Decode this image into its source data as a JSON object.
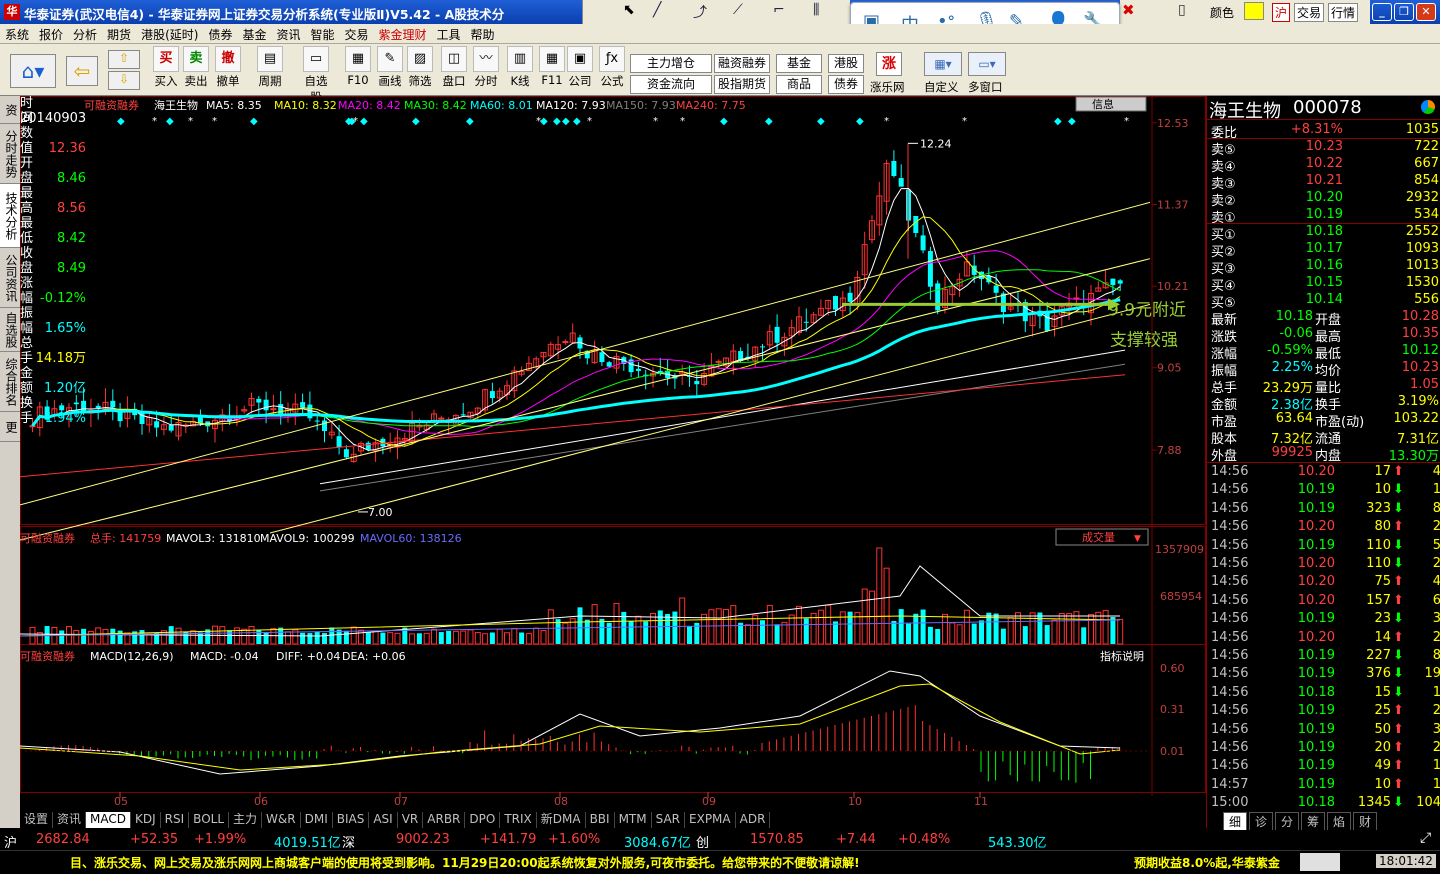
{
  "title": "华泰证券(武汉电信4)  -  华泰证券网上证券交易分析系统(专业版Ⅱ)V5.42  -  A股技术分",
  "titlebar_right": {
    "color_label": "颜色",
    "b1": "沪",
    "b2": "交易",
    "b3": "行情"
  },
  "menu": [
    "系统",
    "报价",
    "分析",
    "期货",
    "港股(延时)",
    "债券",
    "基金",
    "资讯",
    "智能",
    "交易",
    "紫金理财",
    "工具",
    "帮助"
  ],
  "toolbar": {
    "items": [
      "买入",
      "卖出",
      "撤单",
      "周期",
      "自选股",
      "F10",
      "画线",
      "筛选",
      "盘口",
      "分时",
      "K线",
      "F11",
      "公司",
      "公式"
    ],
    "icons": [
      "买",
      "卖",
      "撤"
    ],
    "w1": "主力增仓",
    "w2": "资金流向",
    "w3": "融资融券",
    "w4": "股指期货",
    "w5": "基金",
    "w6": "商品",
    "w7": "港股",
    "w8": "债券",
    "zhang": "涨",
    "zhangle": "涨乐网",
    "custom": "自定义",
    "multi": "多窗口"
  },
  "sidebar": [
    "资讯",
    "分时走势",
    "技术分析",
    "公司资讯",
    "自选股",
    "综合排名",
    "更多..."
  ],
  "info": {
    "rows": [
      {
        "label": "时间",
        "value": "20140903",
        "color": "#ffffff"
      },
      {
        "label": "数值",
        "value": "12.36",
        "color": "#ff4040"
      },
      {
        "label": "开盘",
        "value": "8.46",
        "color": "#00ff00"
      },
      {
        "label": "最高",
        "value": "8.56",
        "color": "#ff4040"
      },
      {
        "label": "最低",
        "value": "8.42",
        "color": "#00ff00"
      },
      {
        "label": "收盘",
        "value": "8.49",
        "color": "#00ff00"
      },
      {
        "label": "涨幅",
        "value": "-0.12%",
        "color": "#00ff00"
      },
      {
        "label": "振幅",
        "value": "1.65%",
        "color": "#00ffff"
      },
      {
        "label": "总手",
        "value": "14.18万",
        "color": "#ffff00"
      },
      {
        "label": "金额",
        "value": "1.20亿",
        "color": "#00ffff"
      },
      {
        "label": "换手",
        "value": "1.94%",
        "color": "#00ffff"
      }
    ]
  },
  "kline": {
    "source": "可融资融券",
    "name": "海王生物",
    "ma": [
      {
        "label": "MA5: 8.35",
        "color": "#ffffff"
      },
      {
        "label": "MA10: 8.32",
        "color": "#ffff00"
      },
      {
        "label": "MA20: 8.42",
        "color": "#ff00ff"
      },
      {
        "label": "MA30: 8.42",
        "color": "#00ff00"
      },
      {
        "label": "MA60: 8.01",
        "color": "#00ffff"
      },
      {
        "label": "MA120: 7.93",
        "color": "#ffffff"
      },
      {
        "label": "MA150: 7.93",
        "color": "#808080"
      },
      {
        "label": "MA240: 7.75",
        "color": "#ff4040"
      }
    ],
    "y_ticks": [
      "12.53",
      "11.37",
      "10.21",
      "9.05",
      "7.88"
    ],
    "x_ticks": [
      "05",
      "06",
      "07",
      "08",
      "09",
      "10",
      "11"
    ],
    "high_label": "12.24",
    "low_label": "7.00",
    "annotation1": "9.9元附近",
    "annotation2": "支撑较强",
    "info_btn": "信息"
  },
  "vol": {
    "source": "可融资融券",
    "total": "总手: 141759",
    "mv3": "MAVOL3: 131810",
    "mv9": "MAVOL9: 100299",
    "mv60": "MAVOL60: 138126",
    "dropdown": "成交量",
    "y_ticks": [
      "1357909",
      "685954"
    ]
  },
  "macd": {
    "source": "可融资融券",
    "label": "MACD(12,26,9)",
    "macd": "MACD: -0.04",
    "diff": "DIFF: +0.04",
    "dea": "DEA: +0.06",
    "btn": "指标说明",
    "y_ticks": [
      "0.60",
      "0.31",
      "0.01"
    ]
  },
  "tabs": [
    "设置",
    "资讯",
    "MACD",
    "KDJ",
    "RSI",
    "BOLL",
    "主力",
    "W&R",
    "DMI",
    "BIAS",
    "ASI",
    "VR",
    "ARBR",
    "DPO",
    "TRIX",
    "新DMA",
    "BBI",
    "MTM",
    "SAR",
    "EXPMA",
    "ADR"
  ],
  "stock": {
    "name": "海王生物",
    "code": "000078"
  },
  "quote": [
    {
      "l": "委比",
      "v": "+8.31%",
      "vc": "#ff4040",
      "r": "1035",
      "rc": "#ffff00"
    },
    {
      "l": "卖⑤",
      "v": "10.23",
      "vc": "#ff4040",
      "r": "722",
      "rc": "#ffff00"
    },
    {
      "l": "卖④",
      "v": "10.22",
      "vc": "#ff4040",
      "r": "667",
      "rc": "#ffff00"
    },
    {
      "l": "卖③",
      "v": "10.21",
      "vc": "#ff4040",
      "r": "854",
      "rc": "#ffff00"
    },
    {
      "l": "卖②",
      "v": "10.20",
      "vc": "#00ff00",
      "r": "2932",
      "rc": "#ffff00"
    },
    {
      "l": "卖①",
      "v": "10.19",
      "vc": "#00ff00",
      "r": "534",
      "rc": "#ffff00"
    },
    {
      "l": "买①",
      "v": "10.18",
      "vc": "#00ff00",
      "r": "2552",
      "rc": "#ffff00"
    },
    {
      "l": "买②",
      "v": "10.17",
      "vc": "#00ff00",
      "r": "1093",
      "rc": "#ffff00"
    },
    {
      "l": "买③",
      "v": "10.16",
      "vc": "#00ff00",
      "r": "1013",
      "rc": "#ffff00"
    },
    {
      "l": "买④",
      "v": "10.15",
      "vc": "#00ff00",
      "r": "1530",
      "rc": "#ffff00"
    },
    {
      "l": "买⑤",
      "v": "10.14",
      "vc": "#00ff00",
      "r": "556",
      "rc": "#ffff00"
    }
  ],
  "stats": [
    {
      "l": "最新",
      "v": "10.18",
      "vc": "#00ff00",
      "l2": "开盘",
      "v2": "10.28",
      "v2c": "#ff4040"
    },
    {
      "l": "涨跌",
      "v": "-0.06",
      "vc": "#00ff00",
      "l2": "最高",
      "v2": "10.35",
      "v2c": "#ff4040"
    },
    {
      "l": "涨幅",
      "v": "-0.59%",
      "vc": "#00ff00",
      "l2": "最低",
      "v2": "10.12",
      "v2c": "#00ff00"
    },
    {
      "l": "振幅",
      "v": "2.25%",
      "vc": "#00ffff",
      "l2": "均价",
      "v2": "10.23",
      "v2c": "#ff4040"
    },
    {
      "l": "总手",
      "v": "23.29万",
      "vc": "#ffff00",
      "l2": "量比",
      "v2": "1.05",
      "v2c": "#ff4040"
    },
    {
      "l": "金额",
      "v": "2.38亿",
      "vc": "#00ffff",
      "l2": "换手",
      "v2": "3.19%",
      "v2c": "#ffff00"
    },
    {
      "l": "市盈",
      "v": "63.64",
      "vc": "#ffff00",
      "l2": "市盈(动)",
      "v2": "103.22",
      "v2c": "#ffff00"
    },
    {
      "l": "股本",
      "v": "7.32亿",
      "vc": "#ffff00",
      "l2": "流通",
      "v2": "7.31亿",
      "v2c": "#ffff00"
    },
    {
      "l": "外盘",
      "v": "99925",
      "vc": "#ff4040",
      "l2": "内盘",
      "v2": "13.30万",
      "v2c": "#00ff00"
    }
  ],
  "ticks": [
    {
      "t": "14:56",
      "p": "10.20",
      "pc": "#ff4040",
      "v": "17",
      "d": "up",
      "n": "4"
    },
    {
      "t": "14:56",
      "p": "10.19",
      "pc": "#00ff00",
      "v": "10",
      "d": "down",
      "n": "1"
    },
    {
      "t": "14:56",
      "p": "10.19",
      "pc": "#00ff00",
      "v": "323",
      "d": "down",
      "n": "8"
    },
    {
      "t": "14:56",
      "p": "10.20",
      "pc": "#ff4040",
      "v": "80",
      "d": "up",
      "n": "2"
    },
    {
      "t": "14:56",
      "p": "10.19",
      "pc": "#00ff00",
      "v": "110",
      "d": "down",
      "n": "5"
    },
    {
      "t": "14:56",
      "p": "10.20",
      "pc": "#ff4040",
      "v": "110",
      "d": "down",
      "n": "2"
    },
    {
      "t": "14:56",
      "p": "10.20",
      "pc": "#ff4040",
      "v": "75",
      "d": "up",
      "n": "4"
    },
    {
      "t": "14:56",
      "p": "10.20",
      "pc": "#ff4040",
      "v": "157",
      "d": "up",
      "n": "6"
    },
    {
      "t": "14:56",
      "p": "10.19",
      "pc": "#00ff00",
      "v": "23",
      "d": "down",
      "n": "3"
    },
    {
      "t": "14:56",
      "p": "10.20",
      "pc": "#ff4040",
      "v": "14",
      "d": "up",
      "n": "2"
    },
    {
      "t": "14:56",
      "p": "10.19",
      "pc": "#00ff00",
      "v": "227",
      "d": "down",
      "n": "8"
    },
    {
      "t": "14:56",
      "p": "10.19",
      "pc": "#00ff00",
      "v": "376",
      "d": "down",
      "n": "19"
    },
    {
      "t": "14:56",
      "p": "10.18",
      "pc": "#00ff00",
      "v": "15",
      "d": "down",
      "n": "1"
    },
    {
      "t": "14:56",
      "p": "10.19",
      "pc": "#00ff00",
      "v": "25",
      "d": "up",
      "n": "2"
    },
    {
      "t": "14:56",
      "p": "10.19",
      "pc": "#00ff00",
      "v": "50",
      "d": "up",
      "n": "3"
    },
    {
      "t": "14:56",
      "p": "10.19",
      "pc": "#00ff00",
      "v": "20",
      "d": "up",
      "n": "2"
    },
    {
      "t": "14:56",
      "p": "10.19",
      "pc": "#00ff00",
      "v": "49",
      "d": "up",
      "n": "1"
    },
    {
      "t": "14:57",
      "p": "10.19",
      "pc": "#00ff00",
      "v": "10",
      "d": "up",
      "n": "1"
    },
    {
      "t": "15:00",
      "p": "10.18",
      "pc": "#00ff00",
      "v": "1345",
      "d": "down",
      "n": "104"
    }
  ],
  "rtabs": [
    "细",
    "诊",
    "分",
    "筹",
    "焰",
    "财"
  ],
  "status": {
    "sh": "沪",
    "sh_idx": "2682.84",
    "sh_chg": "+52.35",
    "sh_pct": "+1.99%",
    "sh_amt": "4019.51亿",
    "sz": "深",
    "sz_idx": "9002.23",
    "sz_chg": "+141.79",
    "sz_pct": "+1.60%",
    "sz_amt": "3084.67亿",
    "cy": "创",
    "cy_idx": "1570.85",
    "cy_chg": "+7.44",
    "cy_pct": "+0.48%",
    "cy_amt": "543.30亿"
  },
  "marquee": {
    "text": "目、涨乐交易、网上交易及涨乐网网上商城客户端的使用将受到影响。11月29日20:00起系统恢复对外服务,可夜市委托。给您带来的不便敬请谅解!",
    "right": "预期收益8.0%起,华泰紫金",
    "time": "18:01:42"
  }
}
